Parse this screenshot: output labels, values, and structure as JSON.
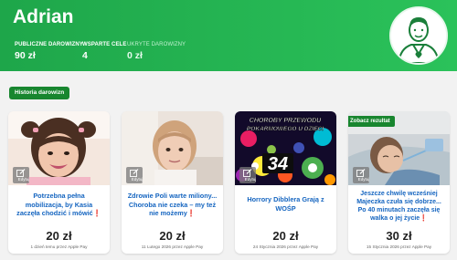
{
  "profile": {
    "name": "Adrian",
    "stats": [
      {
        "label": "PUBLICZNE DAROWIZNY",
        "value": "90 zł"
      },
      {
        "label": "WSPARTE CELE",
        "value": "4"
      },
      {
        "label": "UKRYTE DAROWIZNY",
        "value": "0 zł"
      }
    ]
  },
  "history_button": "Historia darowizn",
  "edit_label": "Edytuj",
  "result_badge": "Zobacz rezultat",
  "poster": {
    "line1": "CHOROBY PRZEWODU",
    "line2": "POKARMOWEGO U DZIECI",
    "number": "34"
  },
  "cards": [
    {
      "title": "Potrzebna pełna mobilizacja, by Kasia zaczęła chodzić i mówić",
      "title_suffix": "❗",
      "amount": "20 zł",
      "date": "1 dzień temu przez Apple Pay"
    },
    {
      "title": "Zdrowie Poli warte miliony... Choroba nie czeka – my też nie możemy",
      "title_suffix": "❗",
      "amount": "20 zł",
      "date": "11 Lutego 2026 przez Apple Pay"
    },
    {
      "title": "Horrory Dibblera Grają z WOŚP",
      "title_suffix": "",
      "amount": "20 zł",
      "date": "24 Stycznia 2026 przez Apple Pay"
    },
    {
      "title": "Jeszcze chwilę wcześniej Majeczka czuła się dobrze... Po 40 minutach zaczęła się walka o jej życie",
      "title_suffix": "❗",
      "amount": "30 zł",
      "date": "15 Stycznia 2026 przez Apple Pay"
    }
  ],
  "colors": {
    "header_green": "#2bc25a",
    "badge_green": "#18862f",
    "link_blue": "#1565c0"
  }
}
